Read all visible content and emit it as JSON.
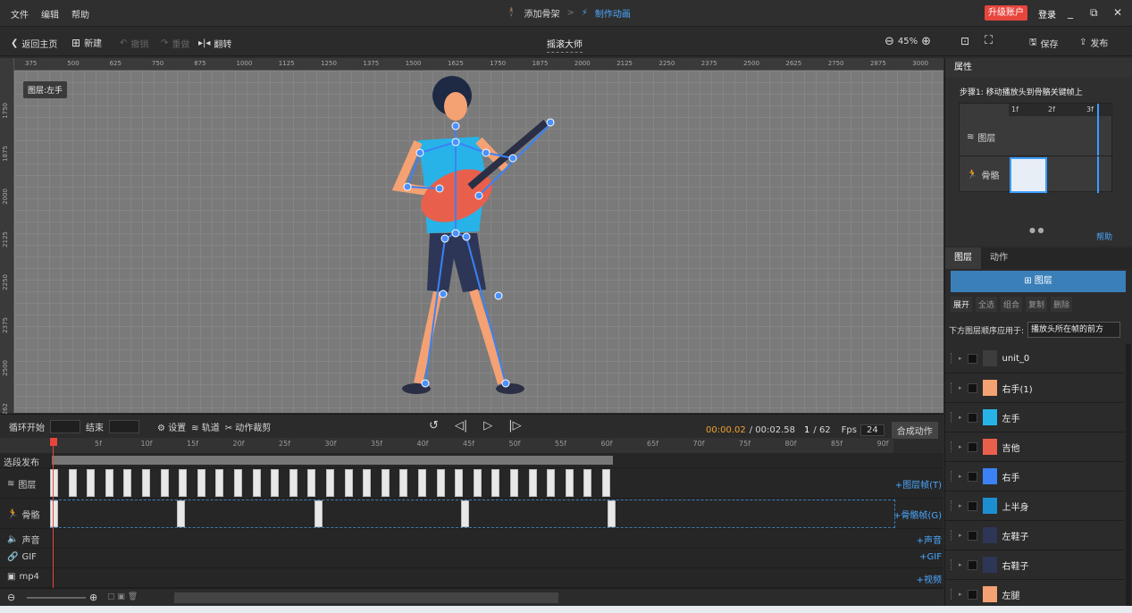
{
  "menu": [
    "文件",
    "编辑",
    "帮助"
  ],
  "modes": {
    "rig": "添加骨架",
    "animate": "制作动画",
    "separator": ">"
  },
  "account": {
    "upgrade": "升级账户",
    "login": "登录"
  },
  "window": {
    "min": "_",
    "restore": "⧉",
    "close": "✕"
  },
  "toolbar": {
    "back": "返回主页",
    "new": "新建",
    "undo": "撤销",
    "redo": "重做",
    "flip": "翻转",
    "doc_name": "摇滚大师",
    "zoom": "45%",
    "save": "保存",
    "publish": "发布"
  },
  "ruler": {
    "h": [
      "375",
      "500",
      "625",
      "750",
      "875",
      "1000",
      "1125",
      "1250",
      "1375",
      "1500",
      "1625",
      "1750",
      "1875",
      "2000",
      "2125",
      "2250",
      "2375",
      "2500",
      "2625",
      "2750",
      "2875",
      "3000"
    ],
    "v": [
      "1750",
      "1875",
      "2000",
      "2125",
      "2250",
      "2375",
      "2500",
      "262"
    ]
  },
  "canvas": {
    "layer_tag": "图层:左手"
  },
  "props": {
    "title": "属性",
    "step": "步骤1: 移动播放头到骨骼关键帧上",
    "frames": [
      "1f",
      "2f",
      "3f"
    ],
    "row_layer": "图层",
    "row_bone": "骨骼",
    "help": "帮助"
  },
  "panel_tabs": [
    "图层",
    "动作"
  ],
  "layer_panel": {
    "add": "图层",
    "ops": [
      "展开",
      "全选",
      "组合",
      "复制",
      "删除"
    ],
    "order_label": "下方图层顺序应用于:",
    "order_value": "播放头所在帧的前方"
  },
  "layers": [
    "unit_0",
    "右手(1)",
    "左手",
    "吉他",
    "右手",
    "上半身",
    "左鞋子",
    "右鞋子",
    "左腿"
  ],
  "timeline": {
    "loop_start": "循环开始",
    "end": "结束",
    "settings": "设置",
    "track": "轨道",
    "cut": "动作裁剪",
    "time": "00:00.02",
    "total": "/ 00:02.58",
    "frame": "1",
    "frames": "/ 62",
    "fps_label": "Fps",
    "fps": "24",
    "combine": "合成动作",
    "ticks": [
      "5f",
      "10f",
      "15f",
      "20f",
      "25f",
      "30f",
      "35f",
      "40f",
      "45f",
      "50f",
      "55f",
      "60f",
      "65f",
      "70f",
      "75f",
      "80f",
      "85f",
      "90f"
    ],
    "tracks": [
      {
        "label": "选段发布",
        "add": ""
      },
      {
        "label": "图层",
        "add": "图层帧(T)"
      },
      {
        "label": "骨骼",
        "add": "骨骼帧(G)"
      },
      {
        "label": "声音",
        "add": "声音"
      },
      {
        "label": "GIF",
        "add": "GIF"
      },
      {
        "label": "mp4",
        "add": "视频"
      }
    ]
  },
  "colors": {
    "accent": "#3a7fb8",
    "upgrade": "#e8453c",
    "bone": "#3b82f6",
    "time": "#f0a030"
  }
}
